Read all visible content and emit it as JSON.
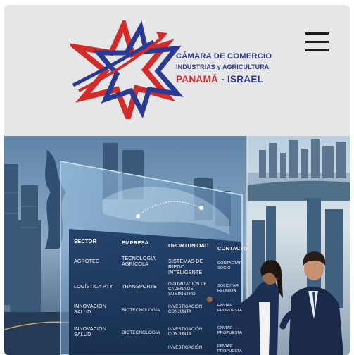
{
  "header": {
    "org_line1": "CÁMARA DE COMERCIO",
    "org_line2": "INDUSTRIAS y AGRICULTURA",
    "country_a": "PANAMÁ",
    "country_sep": " - ",
    "country_b": "ISRAEL",
    "menu_icon": "hamburger-menu-icon"
  },
  "colors": {
    "brand_red": "#d32b2a",
    "brand_blue": "#2a3a92",
    "header_bg": "#e6e5e7"
  },
  "hero": {
    "board": {
      "headers": [
        "SECTOR",
        "EMPRESA",
        "OPORTUNIDAD",
        "CONTACTO"
      ],
      "rows": [
        [
          "AGROTEC",
          "TECNOLOGÍA AGRÍCOLA",
          "SISTEMAS DE RIEGO INTELIGENTE",
          "CONTACTAR SOCIO"
        ],
        [
          "LOGÍSTICA PTY",
          "TRANSPORTE",
          "OPTIMIZACIÓN DE CADENA DE SUMINISTRO",
          "SOLICITAR REUNIÓN"
        ],
        [
          "INNOVACIÓN SALUD",
          "BIOTECNOLOGÍA",
          "INVESTIGACIÓN CONJUNTA",
          "ENVIAR PROPUESTA"
        ],
        [
          "INNOVACIÓN SALUD",
          "BIOTECNOLOGÍA",
          "INVESTIGACIÓN CONJUNTA",
          "ENVIAR PROPUESTA"
        ],
        [
          "",
          "",
          "INVESTIGACIÓN",
          "ENVIAR PROPUESTA"
        ]
      ]
    }
  }
}
